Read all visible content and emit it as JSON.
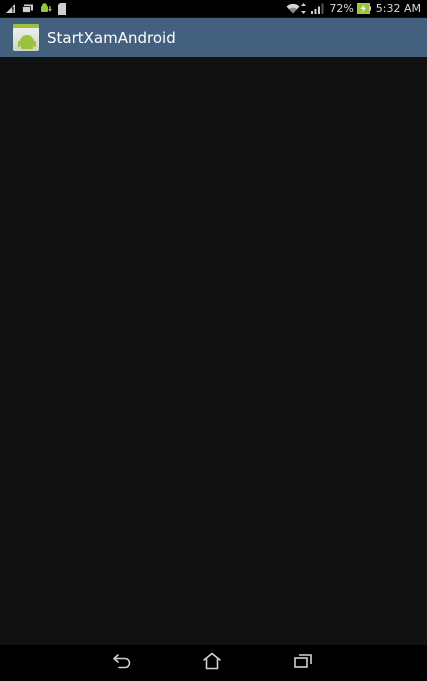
{
  "status_bar": {
    "battery_percent": "72%",
    "time": "5:32 AM",
    "icons": [
      "signal-warning-icon",
      "message-icon",
      "android-download-icon",
      "sd-card-icon",
      "wifi-icon",
      "data-transfer-icon",
      "cell-signal-icon",
      "battery-charging-icon"
    ]
  },
  "action_bar": {
    "title": "StartXamAndroid",
    "icon": "app-launcher-icon",
    "color": "#44607f"
  },
  "content": {
    "background": "#111111"
  },
  "nav_bar": {
    "buttons": [
      "back-icon",
      "home-icon",
      "recent-apps-icon"
    ]
  }
}
